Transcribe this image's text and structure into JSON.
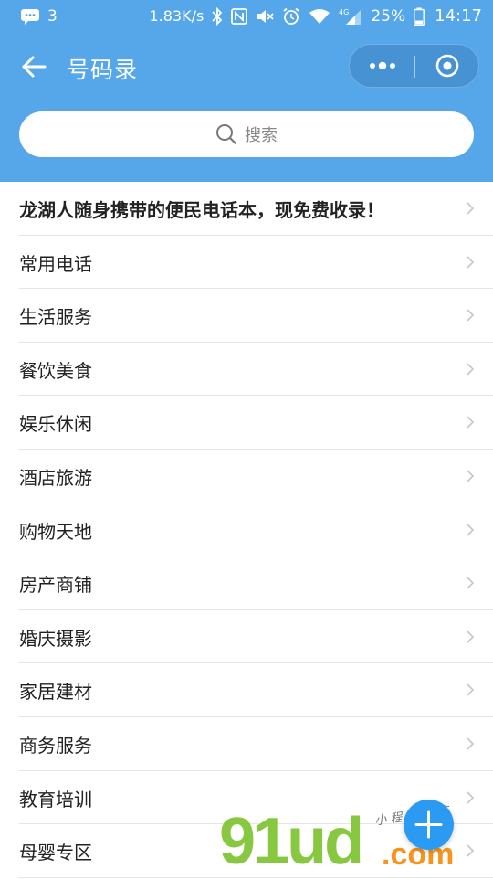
{
  "status_bar": {
    "notification_count": "3",
    "network_speed": "1.83K/s",
    "network_type": "4G",
    "battery": "25%",
    "time": "14:17"
  },
  "nav": {
    "title": "号码录"
  },
  "search": {
    "placeholder": "搜索"
  },
  "list": {
    "items": [
      {
        "label": "龙湖人随身携带的便民电话本，现免费收录！"
      },
      {
        "label": "常用电话"
      },
      {
        "label": "生活服务"
      },
      {
        "label": "餐饮美食"
      },
      {
        "label": "娱乐休闲"
      },
      {
        "label": "酒店旅游"
      },
      {
        "label": "购物天地"
      },
      {
        "label": "房产商铺"
      },
      {
        "label": "婚庆摄影"
      },
      {
        "label": "家居建材"
      },
      {
        "label": "商务服务"
      },
      {
        "label": "教育培训"
      },
      {
        "label": "母婴专区"
      }
    ]
  },
  "watermark": {
    "main": "91ud",
    "suffix": ".com",
    "sub": "小 程 序 商 店"
  },
  "colors": {
    "header_bg": "#55a7ea",
    "fab": "#2b9af3",
    "divider": "#e6e6e6",
    "chevron": "#c7c7c7"
  }
}
